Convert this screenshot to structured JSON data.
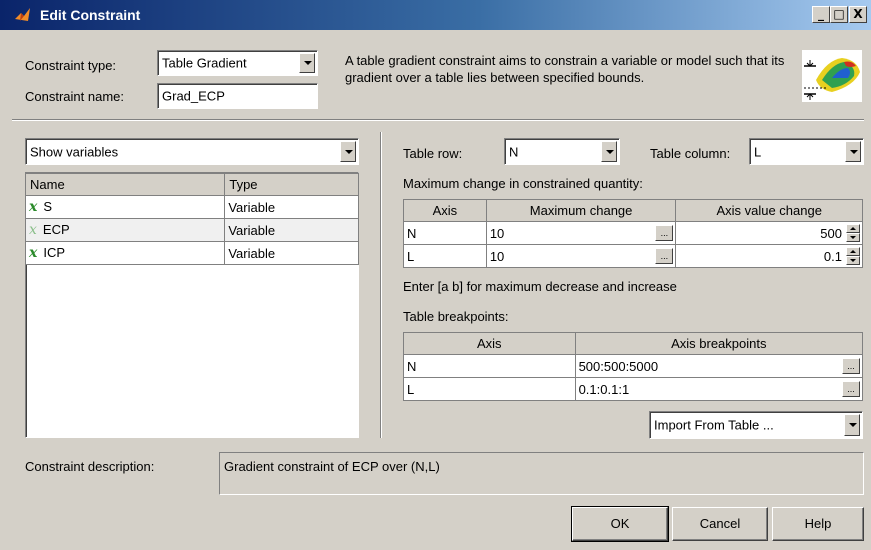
{
  "window": {
    "title": "Edit Constraint",
    "controls": [
      "_",
      "□",
      "X"
    ]
  },
  "constraint_type": {
    "label": "Constraint type:",
    "value": "Table Gradient"
  },
  "constraint_name": {
    "label": "Constraint name:",
    "value": "Grad_ECP"
  },
  "description_text": "A table gradient constraint aims to constrain a variable or model such that its gradient over a table lies between specified bounds.",
  "variables": {
    "filter": "Show variables",
    "columns": [
      "Name",
      "Type"
    ],
    "rows": [
      {
        "name": "S",
        "type": "Variable",
        "icon": "x-variable-icon"
      },
      {
        "name": "ECP",
        "type": "Variable",
        "icon": "x-variable-icon"
      },
      {
        "name": "ICP",
        "type": "Variable",
        "icon": "x-variable-icon"
      }
    ]
  },
  "table_row": {
    "label": "Table row:",
    "value": "N"
  },
  "table_column": {
    "label": "Table column:",
    "value": "L"
  },
  "max_change": {
    "label": "Maximum change in constrained quantity:",
    "columns": [
      "Axis",
      "Maximum change",
      "Axis value change"
    ],
    "rows": [
      {
        "axis": "N",
        "max": "10",
        "axis_change": "500"
      },
      {
        "axis": "L",
        "max": "10",
        "axis_change": "0.1"
      }
    ],
    "hint": "Enter [a b] for maximum decrease and increase"
  },
  "breakpoints": {
    "label": "Table breakpoints:",
    "columns": [
      "Axis",
      "Axis breakpoints"
    ],
    "rows": [
      {
        "axis": "N",
        "value": "500:500:5000"
      },
      {
        "axis": "L",
        "value": "0.1:0.1:1"
      }
    ],
    "import_label": "Import From Table ..."
  },
  "constraint_description": {
    "label": "Constraint description:",
    "value": "Gradient constraint of ECP over (N,L)"
  },
  "buttons": {
    "ok": "OK",
    "cancel": "Cancel",
    "help": "Help"
  },
  "ellipsis": "..."
}
